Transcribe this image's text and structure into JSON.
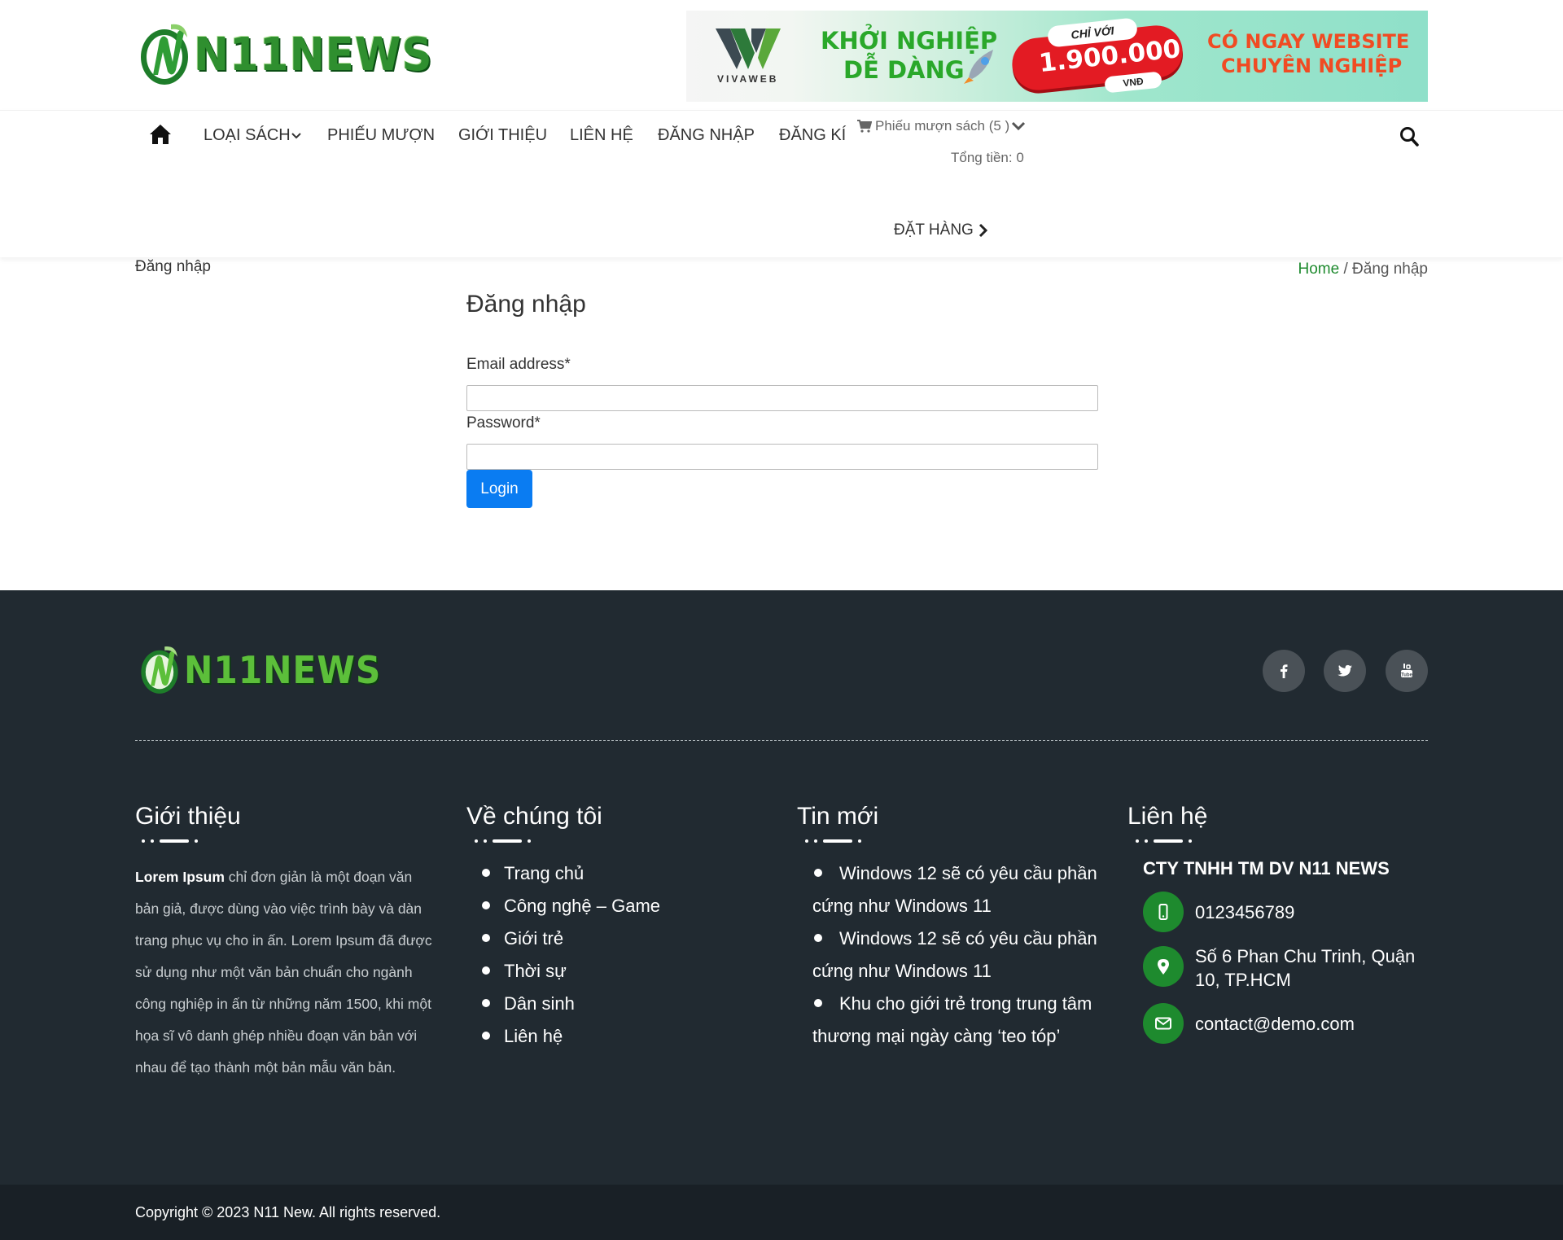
{
  "brand": {
    "logo_text": "N11NEWS",
    "primary_color": "#1e8a2e",
    "accent_blue": "#0a7cf2"
  },
  "banner": {
    "brand_name": "VIVAWEB",
    "line1": "KHỞI NGHIỆP",
    "line2": "DỄ DÀNG",
    "pill_top": "CHỈ VỚI",
    "price": "1.900.000",
    "pill_bottom": "VNĐ",
    "right_line1": "CÓ NGAY WEBSITE",
    "right_line2": "CHUYÊN NGHIỆP"
  },
  "nav": {
    "home_icon": "home-icon",
    "items": [
      {
        "label": "LOẠI SÁCH"
      },
      {
        "label": "PHIẾU MƯỢN"
      },
      {
        "label": "GIỚI THIỆU"
      },
      {
        "label": "LIÊN HỆ"
      },
      {
        "label": "ĐĂNG NHẬP"
      },
      {
        "label": "ĐĂNG KÍ"
      }
    ],
    "cart_label": "Phiếu mượn sách (5 )",
    "cart_total": "Tổng tiền: 0",
    "order_label": "ĐẶT HÀNG",
    "search_icon": "search-icon"
  },
  "page": {
    "heading": "Đăng nhập",
    "breadcrumb_home": "Home",
    "breadcrumb_sep": " / ",
    "breadcrumb_current": "Đăng nhập"
  },
  "login_form": {
    "title": "Đăng nhập",
    "email_label": "Email address*",
    "email_value": "",
    "password_label": "Password*",
    "password_value": "",
    "submit_label": "Login"
  },
  "footer": {
    "logo_text": "N11NEWS",
    "social": [
      "facebook-icon",
      "twitter-icon",
      "youtube-icon"
    ],
    "about": {
      "title": "Giới thiệu",
      "lead": "Lorem Ipsum",
      "text": " chỉ đơn giản là một đoạn văn bản giả, được dùng vào việc trình bày và dàn trang phục vụ cho in ấn. Lorem Ipsum đã được sử dụng như một văn bản chuẩn cho ngành công nghiệp in ấn từ những năm 1500, khi một họa sĩ vô danh ghép nhiều đoạn văn bản với nhau để tạo thành một bản mẫu văn bản."
    },
    "about_us": {
      "title": "Về chúng tôi",
      "links": [
        "Trang chủ",
        "Công nghệ – Game",
        "Giới trẻ",
        "Thời sự",
        "Dân sinh",
        "Liên hệ"
      ]
    },
    "news": {
      "title": "Tin mới",
      "items": [
        "Windows 12 sẽ có yêu cầu phần cứng như Windows 11",
        "Windows 12 sẽ có yêu cầu phần cứng như Windows 11",
        "Khu cho giới trẻ trong trung tâm thương mại ngày càng ‘teo tóp’"
      ]
    },
    "contact": {
      "title": "Liên hệ",
      "company": "CTY TNHH TM DV N11 NEWS",
      "phone": "0123456789",
      "address": "Số 6 Phan Chu Trinh, Quận 10, TP.HCM",
      "email": "contact@demo.com"
    },
    "copyright": "Copyright © 2023  N11 New. All rights reserved."
  }
}
